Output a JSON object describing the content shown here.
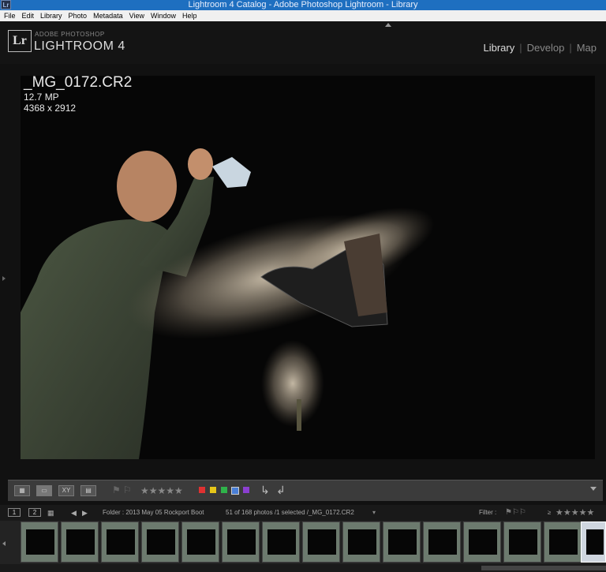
{
  "window": {
    "app_icon": "Lr",
    "title": "Lightroom 4 Catalog - Adobe Photoshop Lightroom - Library"
  },
  "menu": [
    "File",
    "Edit",
    "Library",
    "Photo",
    "Metadata",
    "View",
    "Window",
    "Help"
  ],
  "header": {
    "logo": "Lr",
    "brand_top": "ADOBE PHOTOSHOP",
    "brand_main": "LIGHTROOM 4",
    "modules": [
      "Library",
      "Develop",
      "Map"
    ],
    "active_module": "Library"
  },
  "photo_info": {
    "filename": "_MG_0172.CR2",
    "megapixels": "12.7 MP",
    "dimensions": "4368 x 2912"
  },
  "toolbar": {
    "view_buttons": [
      "grid-view-icon",
      "loupe-view-icon",
      "compare-view-icon",
      "survey-view-icon"
    ],
    "compare_label": "XY",
    "stars": "★★★★★",
    "color_labels": [
      "#e03131",
      "#e6c619",
      "#2fb34a",
      "#4a7fd6",
      "#8b3fd0"
    ]
  },
  "filmbar": {
    "page1": "1",
    "page2": "2",
    "folder_text": "Folder : 2013 May 05 Rockport Boot",
    "count_text": "51 of 168 photos /1 selected /_MG_0172.CR2",
    "filter_label": "Filter :",
    "filter_op": "≥",
    "filter_stars": "★★★★★"
  },
  "filmstrip": {
    "thumb_count": 15,
    "selected_index": 14
  }
}
